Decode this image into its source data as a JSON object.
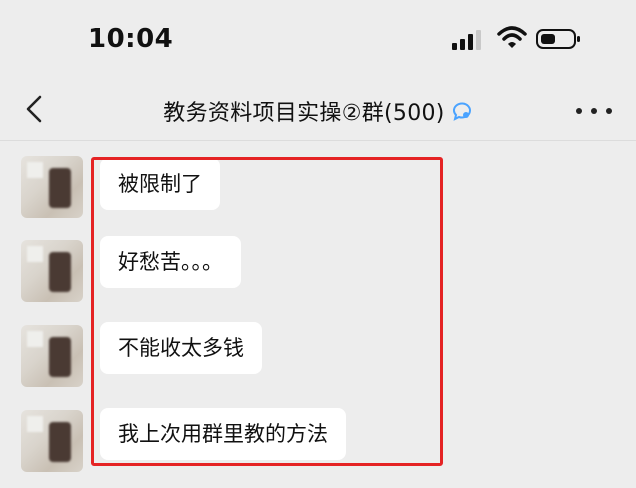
{
  "status_bar": {
    "time": "10:04"
  },
  "nav": {
    "back_label": "<",
    "title": "教务资料项目实操②群(500)"
  },
  "messages": [
    {
      "text": "被限制了"
    },
    {
      "text": "好愁苦。。。"
    },
    {
      "text": "不能收太多钱"
    },
    {
      "text": "我上次用群里教的方法"
    }
  ],
  "colors": {
    "background": "#ededed",
    "bubble": "#ffffff",
    "highlight_border": "#e52324",
    "chat_icon": "#4aa3ff"
  },
  "icons": [
    "chevron-left-icon",
    "group-chat-icon",
    "more-icon",
    "signal-icon",
    "wifi-icon",
    "battery-icon"
  ]
}
